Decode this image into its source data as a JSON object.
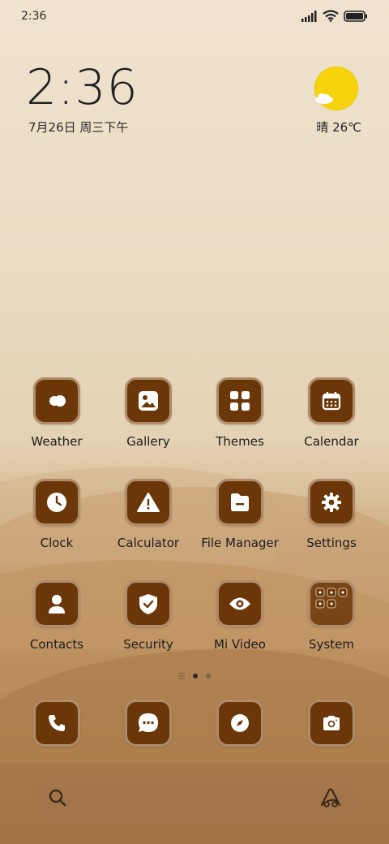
{
  "status_bar": {
    "time": "2:36"
  },
  "clock_widget": {
    "time": "2:36",
    "date": "7月26日 周三下午"
  },
  "weather_widget": {
    "temp": "晴 26℃"
  },
  "apps": [
    {
      "label": "Weather",
      "icon": "weather-cloud-icon"
    },
    {
      "label": "Gallery",
      "icon": "gallery-image-icon"
    },
    {
      "label": "Themes",
      "icon": "themes-grid-icon"
    },
    {
      "label": "Calendar",
      "icon": "calendar-icon"
    },
    {
      "label": "Clock",
      "icon": "clock-icon"
    },
    {
      "label": "Calculator",
      "icon": "calculator-warning-icon"
    },
    {
      "label": "File Manager",
      "icon": "folder-icon"
    },
    {
      "label": "Settings",
      "icon": "gear-icon"
    },
    {
      "label": "Contacts",
      "icon": "person-icon"
    },
    {
      "label": "Security",
      "icon": "shield-check-icon"
    },
    {
      "label": "Mi Video",
      "icon": "eye-icon"
    },
    {
      "label": "System",
      "icon": "folder-grid-icon"
    }
  ],
  "dock": [
    {
      "icon": "phone-icon"
    },
    {
      "icon": "message-icon"
    },
    {
      "icon": "compass-icon"
    },
    {
      "icon": "camera-icon"
    }
  ],
  "colors": {
    "tile": "#6b3608",
    "tile_border": "#ae8c6c",
    "sun": "#f6d30b"
  }
}
